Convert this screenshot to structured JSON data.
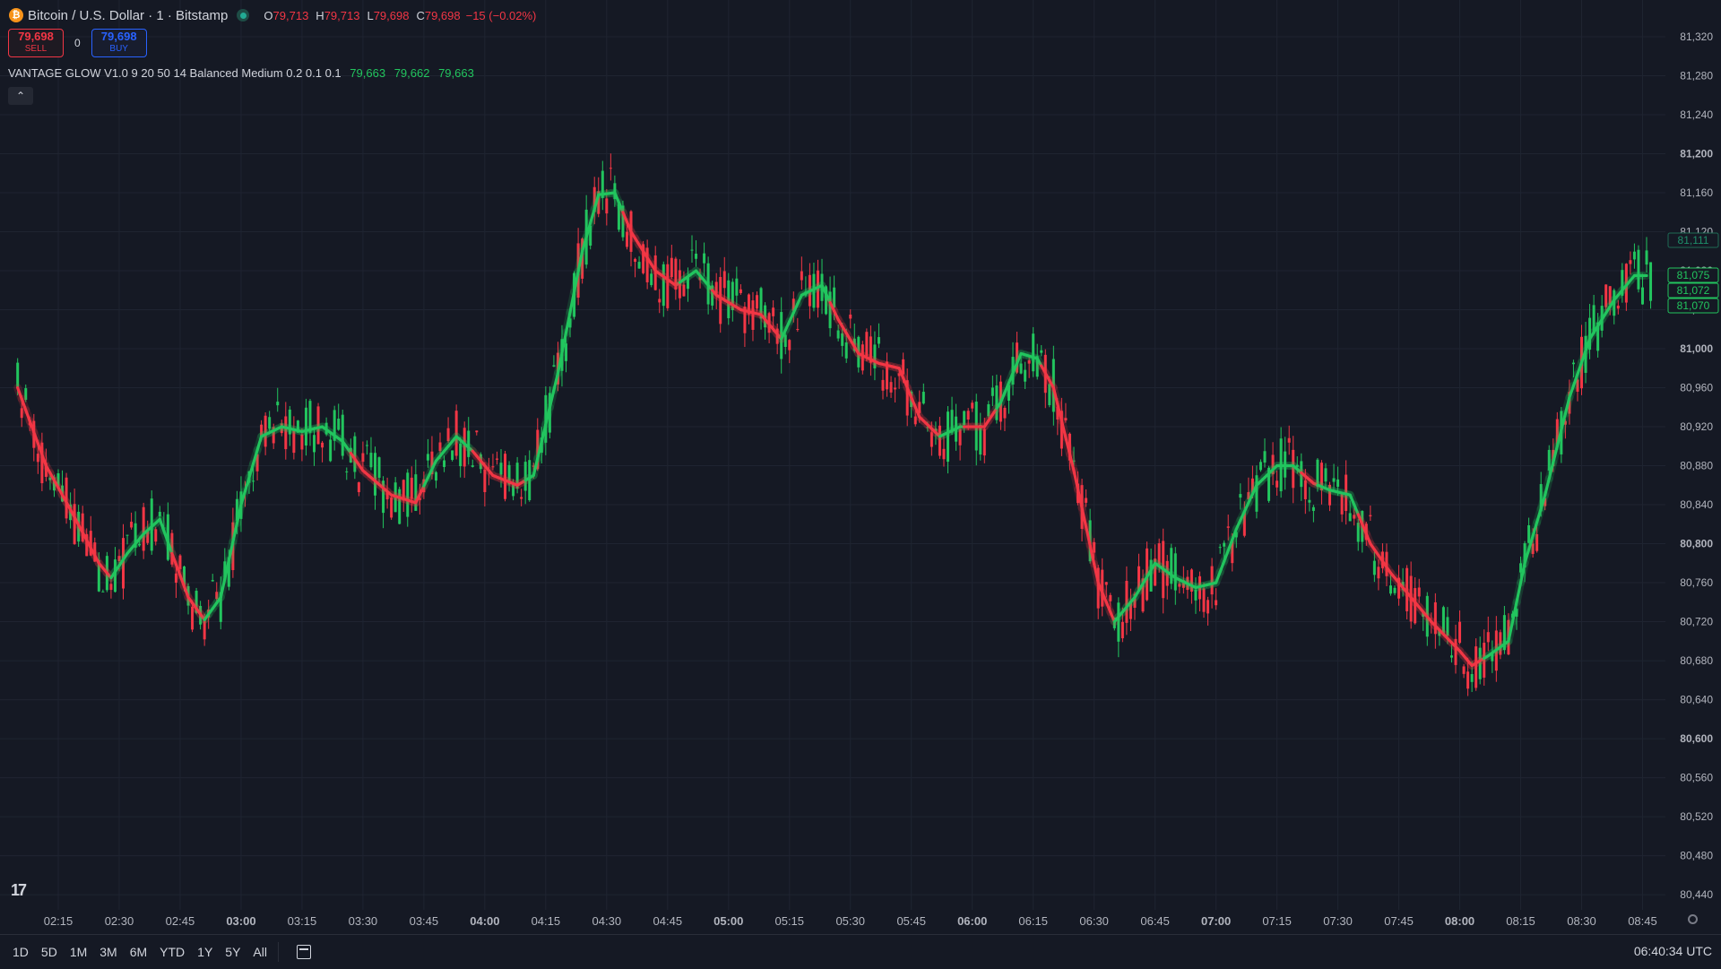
{
  "header": {
    "icon_glyph": "₿",
    "symbol": "Bitcoin / U.S. Dollar · 1 · Bitstamp",
    "ohlc": [
      {
        "key": "O",
        "value": "79,713"
      },
      {
        "key": "H",
        "value": "79,713"
      },
      {
        "key": "L",
        "value": "79,698"
      },
      {
        "key": "C",
        "value": "79,698"
      }
    ],
    "change": "−15 (−0.02%)"
  },
  "trade": {
    "sell_price": "79,698",
    "sell_label": "SELL",
    "spread": "0",
    "buy_price": "79,698",
    "buy_label": "BUY"
  },
  "indicator": {
    "label": "VANTAGE GLOW V1.0 9 20 50 14 Balanced Medium 0.2 0.1 0.1",
    "values": [
      "79,663",
      "79,662",
      "79,663"
    ],
    "collapse_glyph": "⌃"
  },
  "range_buttons": [
    "1D",
    "5D",
    "1M",
    "3M",
    "6M",
    "YTD",
    "1Y",
    "5Y",
    "All"
  ],
  "clock": "06:40:34 UTC",
  "logo": "17",
  "colors": {
    "background": "#151924",
    "up": "#22c55e",
    "down": "#f23645",
    "text": "#d1d4dc"
  },
  "chart_data": {
    "type": "candlestick",
    "y_ticks": [
      {
        "v": 81320,
        "l": "81,320"
      },
      {
        "v": 81280,
        "l": "81,280"
      },
      {
        "v": 81240,
        "l": "81,240"
      },
      {
        "v": 81200,
        "l": "81,200",
        "bold": true
      },
      {
        "v": 81160,
        "l": "81,160"
      },
      {
        "v": 81120,
        "l": "81,120"
      },
      {
        "v": 81080,
        "l": "81,080"
      },
      {
        "v": 81040,
        "l": "81,040"
      },
      {
        "v": 81000,
        "l": "81,000",
        "bold": true
      },
      {
        "v": 80960,
        "l": "80,960"
      },
      {
        "v": 80920,
        "l": "80,920"
      },
      {
        "v": 80880,
        "l": "80,880"
      },
      {
        "v": 80840,
        "l": "80,840"
      },
      {
        "v": 80800,
        "l": "80,800",
        "bold": true
      },
      {
        "v": 80760,
        "l": "80,760"
      },
      {
        "v": 80720,
        "l": "80,720"
      },
      {
        "v": 80680,
        "l": "80,680"
      },
      {
        "v": 80640,
        "l": "80,640"
      },
      {
        "v": 80600,
        "l": "80,600",
        "bold": true
      },
      {
        "v": 80560,
        "l": "80,560"
      },
      {
        "v": 80520,
        "l": "80,520"
      },
      {
        "v": 80480,
        "l": "80,480"
      },
      {
        "v": 80440,
        "l": "80,440"
      }
    ],
    "x_ticks": [
      {
        "t": "02:15"
      },
      {
        "t": "02:30"
      },
      {
        "t": "02:45"
      },
      {
        "t": "03:00",
        "bold": true
      },
      {
        "t": "03:15"
      },
      {
        "t": "03:30"
      },
      {
        "t": "03:45"
      },
      {
        "t": "04:00",
        "bold": true
      },
      {
        "t": "04:15"
      },
      {
        "t": "04:30"
      },
      {
        "t": "04:45"
      },
      {
        "t": "05:00",
        "bold": true
      },
      {
        "t": "05:15"
      },
      {
        "t": "05:30"
      },
      {
        "t": "05:45"
      },
      {
        "t": "06:00",
        "bold": true
      },
      {
        "t": "06:15"
      },
      {
        "t": "06:30"
      },
      {
        "t": "06:45"
      },
      {
        "t": "07:00",
        "bold": true
      },
      {
        "t": "07:15"
      },
      {
        "t": "07:30"
      },
      {
        "t": "07:45"
      },
      {
        "t": "08:00",
        "bold": true
      },
      {
        "t": "08:15"
      },
      {
        "t": "08:30"
      },
      {
        "t": "08:45"
      }
    ],
    "price_labels": [
      {
        "v": 81111,
        "l": "81,111",
        "dim": true
      },
      {
        "v": 81075,
        "l": "81,075"
      },
      {
        "v": 81072,
        "l": "81,072"
      },
      {
        "v": 81070,
        "l": "81,070"
      }
    ],
    "trend_path": [
      [
        "02:05",
        80960
      ],
      [
        "02:12",
        80880
      ],
      [
        "02:18",
        80835
      ],
      [
        "02:25",
        80780
      ],
      [
        "02:28",
        80765
      ],
      [
        "02:32",
        80790
      ],
      [
        "02:36",
        80810
      ],
      [
        "02:40",
        80825
      ],
      [
        "02:43",
        80790
      ],
      [
        "02:47",
        80745
      ],
      [
        "02:51",
        80722
      ],
      [
        "02:55",
        80745
      ],
      [
        "03:00",
        80840
      ],
      [
        "03:05",
        80910
      ],
      [
        "03:10",
        80920
      ],
      [
        "03:15",
        80915
      ],
      [
        "03:20",
        80920
      ],
      [
        "03:25",
        80905
      ],
      [
        "03:30",
        80875
      ],
      [
        "03:37",
        80850
      ],
      [
        "03:43",
        80842
      ],
      [
        "03:48",
        80885
      ],
      [
        "03:53",
        80910
      ],
      [
        "03:57",
        80895
      ],
      [
        "04:02",
        80870
      ],
      [
        "04:08",
        80860
      ],
      [
        "04:12",
        80870
      ],
      [
        "04:18",
        80975
      ],
      [
        "04:24",
        81100
      ],
      [
        "04:28",
        81158
      ],
      [
        "04:32",
        81160
      ],
      [
        "04:36",
        81120
      ],
      [
        "04:42",
        81080
      ],
      [
        "04:47",
        81065
      ],
      [
        "04:52",
        81080
      ],
      [
        "04:57",
        81055
      ],
      [
        "05:03",
        81040
      ],
      [
        "05:08",
        81035
      ],
      [
        "05:13",
        81010
      ],
      [
        "05:18",
        81055
      ],
      [
        "05:23",
        81065
      ],
      [
        "05:27",
        81030
      ],
      [
        "05:32",
        80995
      ],
      [
        "05:37",
        80985
      ],
      [
        "05:42",
        80980
      ],
      [
        "05:47",
        80930
      ],
      [
        "05:52",
        80910
      ],
      [
        "05:57",
        80920
      ],
      [
        "06:03",
        80920
      ],
      [
        "06:07",
        80945
      ],
      [
        "06:12",
        80995
      ],
      [
        "06:16",
        80990
      ],
      [
        "06:20",
        80960
      ],
      [
        "06:25",
        80875
      ],
      [
        "06:31",
        80760
      ],
      [
        "06:35",
        80720
      ],
      [
        "06:40",
        80745
      ],
      [
        "06:45",
        80780
      ],
      [
        "06:50",
        80765
      ],
      [
        "06:55",
        80755
      ],
      [
        "07:00",
        80760
      ],
      [
        "07:05",
        80815
      ],
      [
        "07:10",
        80860
      ],
      [
        "07:15",
        80880
      ],
      [
        "07:19",
        80880
      ],
      [
        "07:24",
        80862
      ],
      [
        "07:28",
        80855
      ],
      [
        "07:33",
        80850
      ],
      [
        "07:38",
        80800
      ],
      [
        "07:43",
        80770
      ],
      [
        "07:48",
        80745
      ],
      [
        "07:53",
        80720
      ],
      [
        "08:00",
        80690
      ],
      [
        "08:03",
        80675
      ],
      [
        "08:07",
        80685
      ],
      [
        "08:12",
        80700
      ],
      [
        "08:16",
        80780
      ],
      [
        "08:21",
        80850
      ],
      [
        "08:27",
        80950
      ],
      [
        "08:32",
        81010
      ],
      [
        "08:38",
        81050
      ],
      [
        "08:43",
        81075
      ]
    ],
    "trend_down_segments": [
      [
        "02:05",
        "02:28"
      ],
      [
        "02:43",
        "02:51"
      ],
      [
        "03:27",
        "03:45"
      ],
      [
        "03:57",
        "04:10"
      ],
      [
        "04:34",
        "04:48"
      ],
      [
        "04:56",
        "05:13"
      ],
      [
        "05:25",
        "05:52"
      ],
      [
        "05:58",
        "06:06"
      ],
      [
        "06:17",
        "06:35"
      ],
      [
        "07:21",
        "07:25"
      ],
      [
        "07:35",
        "08:06"
      ]
    ]
  }
}
